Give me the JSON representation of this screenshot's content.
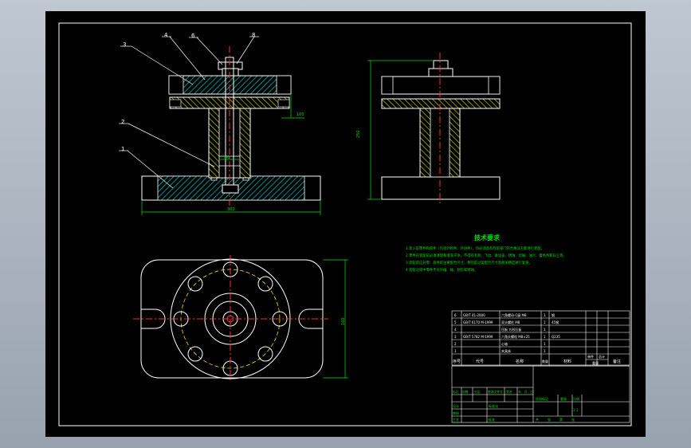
{
  "balloons": [
    "3",
    "4",
    "6",
    "8",
    "2",
    "1"
  ],
  "dims": {
    "base_width": "300",
    "plate_width": "100",
    "center_h": "80",
    "height": "250",
    "plan_height": "160"
  },
  "tech": {
    "title": "技术要求",
    "lines": [
      "1.装入前零件和部件（包括外购件、外协件），均必须具有检验部门的合格证方能进行装配。",
      "2.零件在装配前必须清理和清洗干净，不得有毛刺、飞边、氧化皮、锈蚀、切屑、油污、着色剂和灰尘等。",
      "3.装配前应对零、部件的主要配合尺寸，特别是过盈配合尺寸及相关精度进行复查。",
      "4.装配过程中零件不允许磕、碰、划伤和锈蚀。"
    ]
  },
  "bom": {
    "rows": [
      {
        "no": "6",
        "code": "GB/T 41-2000",
        "name": "六角螺母-C级 M8",
        "qty": "1",
        "mat": "钢",
        "wt": "",
        "note": ""
      },
      {
        "no": "5",
        "code": "GB/T 6170 M-1999",
        "name": "双头螺柱 M8",
        "qty": "1",
        "mat": "45钢",
        "wt": "",
        "note": ""
      },
      {
        "no": "4",
        "code": "",
        "name": "压板 方形压板",
        "qty": "1",
        "mat": "",
        "wt": "",
        "note": ""
      },
      {
        "no": "3",
        "code": "GB/T 5782 M-1999",
        "name": "六角头螺栓 M8×25",
        "qty": "1",
        "mat": "Q235",
        "wt": "",
        "note": ""
      },
      {
        "no": "2",
        "code": "",
        "name": "心轴",
        "qty": "1",
        "mat": "",
        "wt": "",
        "note": ""
      },
      {
        "no": "1",
        "code": "",
        "name": "夹具体",
        "qty": "1",
        "mat": "",
        "wt": "",
        "note": ""
      }
    ],
    "header": {
      "no": "序号",
      "code": "代号",
      "name": "名称",
      "qty": "数量",
      "mat": "材料",
      "wt1": "单件",
      "wt2": "总计",
      "wt3": "重量",
      "note": "备注"
    }
  },
  "title_block": {
    "r1": [
      "标记",
      "处数",
      "分区",
      "更改文件号",
      "签名",
      "年、月、日"
    ],
    "r2": [
      "设计",
      "标准化"
    ],
    "r3": [
      "审核"
    ],
    "r4": [
      "工艺",
      "批准"
    ],
    "stage": [
      "阶段标记",
      "重量",
      "比例"
    ],
    "scale": "1:1",
    "sheet": [
      "共",
      "张",
      "第",
      "张"
    ]
  }
}
